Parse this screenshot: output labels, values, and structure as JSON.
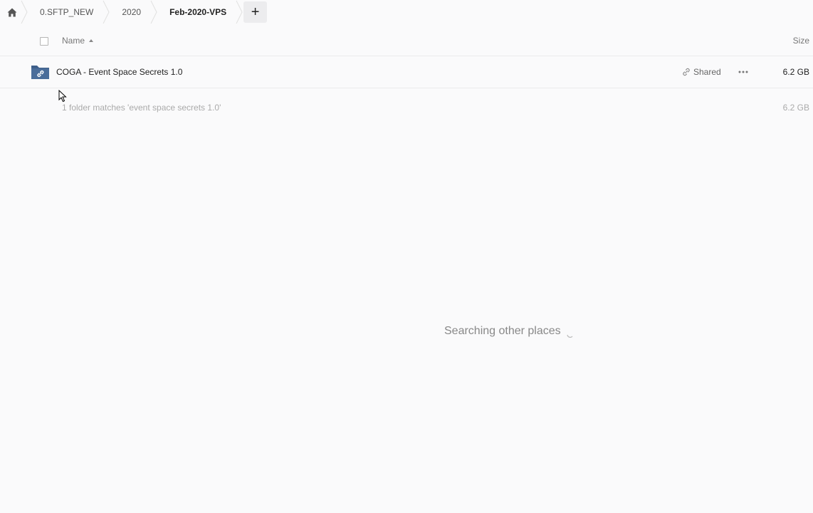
{
  "breadcrumb": {
    "items": [
      "0.SFTP_NEW",
      "2020",
      "Feb-2020-VPS"
    ],
    "add_label": "+"
  },
  "header": {
    "name_label": "Name",
    "size_label": "Size"
  },
  "files": [
    {
      "name": "COGA - Event Space Secrets 1.0",
      "shared_label": "Shared",
      "size": "6.2 GB"
    }
  ],
  "summary": {
    "text": "1 folder matches 'event space secrets 1.0'",
    "size": "6.2 GB"
  },
  "status": {
    "searching_text": "Searching other places"
  },
  "colors": {
    "background": "#fafafb",
    "folder_icon": "#3e5f8a"
  }
}
